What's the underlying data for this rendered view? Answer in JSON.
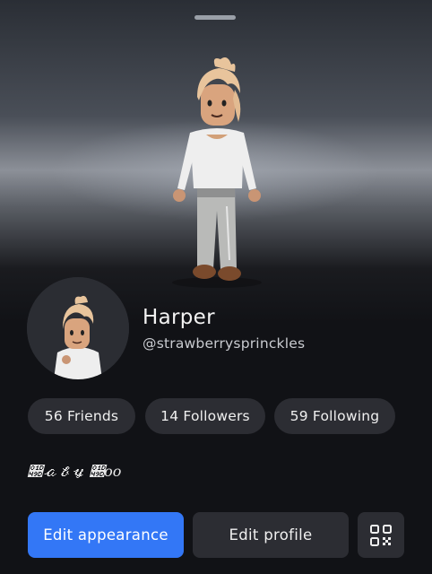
{
  "profile": {
    "display_name": "Harper",
    "username": "@strawberrysprinckles",
    "bio": "𝒝𝒶𝒷𝓎 𝒝𝑜𝑜"
  },
  "stats": {
    "friends": "56 Friends",
    "followers": "14 Followers",
    "following": "59 Following"
  },
  "actions": {
    "edit_appearance": "Edit appearance",
    "edit_profile": "Edit profile",
    "qr_icon": "qr-code-icon"
  },
  "colors": {
    "background": "#111216",
    "primary_button": "#3377f6",
    "pill": "#2c2d33"
  }
}
